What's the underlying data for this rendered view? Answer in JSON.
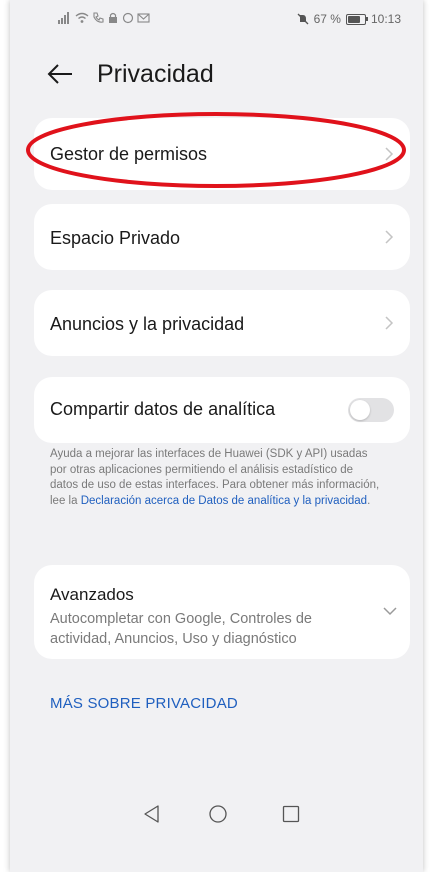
{
  "status_bar": {
    "left_icons": [
      "signal-icon",
      "wifi-icon",
      "call-icon",
      "lock-icon",
      "circle-icon",
      "mail-icon"
    ],
    "battery_percent": "67 %",
    "time": "10:13"
  },
  "header": {
    "title": "Privacidad"
  },
  "items": {
    "gestor": "Gestor de permisos",
    "espacio": "Espacio Privado",
    "anuncios": "Anuncios y la privacidad",
    "compartir": "Compartir datos de analítica"
  },
  "analytics": {
    "description": "Ayuda a mejorar las interfaces de Huawei (SDK y API) usadas por otras aplicaciones permitiendo el análisis estadístico de datos de uso de estas interfaces. Para obtener más información, lee la ",
    "link": "Declaración acerca de Datos de analítica y la privacidad",
    "suffix": ".",
    "toggle_on": false
  },
  "avanzados": {
    "title": "Avanzados",
    "subtitle": "Autocompletar con Google, Controles de actividad, Anuncios, Uso y diagnóstico"
  },
  "more_link": "MÁS SOBRE PRIVACIDAD",
  "colors": {
    "accent": "#1f5fbf",
    "annotation": "#e0121b",
    "background": "#f1f1f3"
  }
}
